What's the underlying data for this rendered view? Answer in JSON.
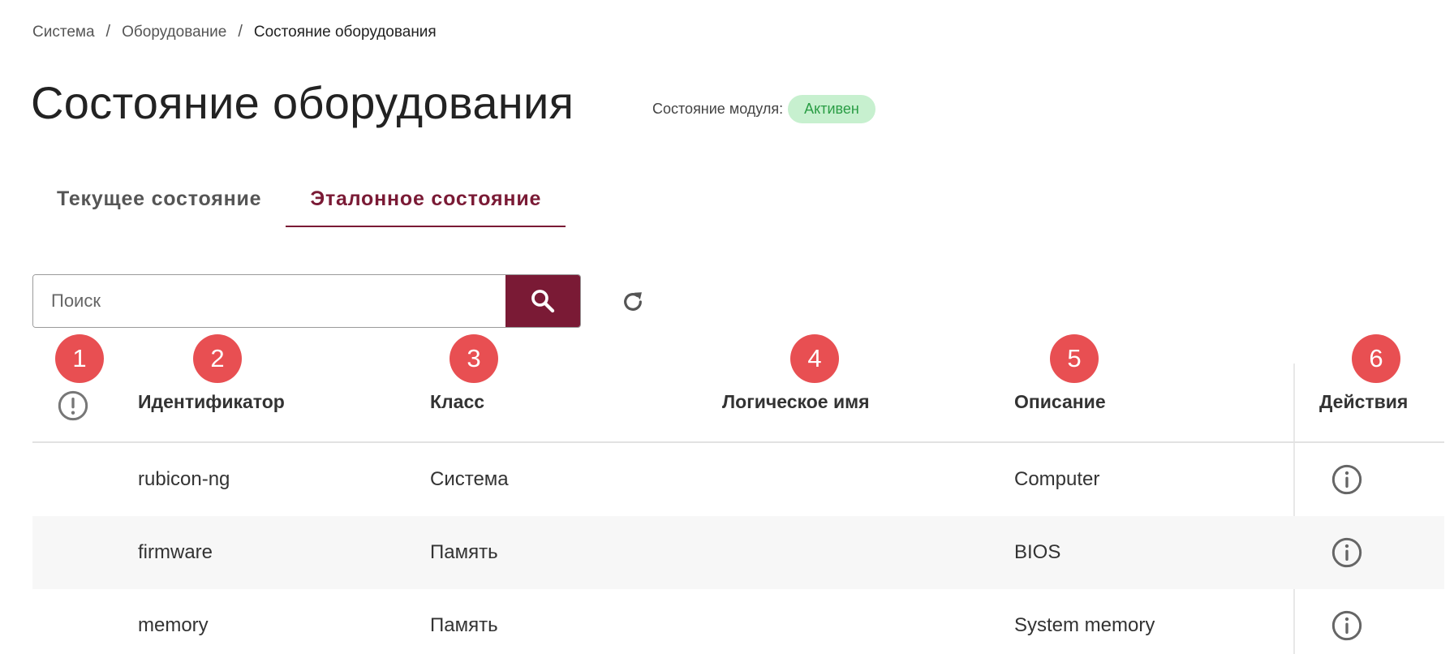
{
  "breadcrumb": {
    "items": [
      "Система",
      "Оборудование",
      "Состояние оборудования"
    ],
    "separator": "/"
  },
  "header": {
    "title": "Состояние оборудования",
    "module_state_label": "Состояние модуля:",
    "module_state_value": "Активен"
  },
  "tabs": [
    {
      "label": "Текущее состояние",
      "active": false
    },
    {
      "label": "Эталонное состояние",
      "active": true
    }
  ],
  "search": {
    "placeholder": "Поиск",
    "button_icon": "search-icon",
    "refresh_icon": "refresh-icon"
  },
  "markers": [
    "1",
    "2",
    "3",
    "4",
    "5",
    "6"
  ],
  "table": {
    "columns": [
      "",
      "Идентификатор",
      "Класс",
      "Логическое имя",
      "Описание",
      "Действия"
    ],
    "status_column_icon": "alert-circle-icon",
    "action_icon": "info-icon",
    "rows": [
      {
        "id": "rubicon-ng",
        "class": "Система",
        "logical_name": "",
        "description": "Computer"
      },
      {
        "id": "firmware",
        "class": "Память",
        "logical_name": "",
        "description": "BIOS"
      },
      {
        "id": "memory",
        "class": "Память",
        "logical_name": "",
        "description": "System memory"
      }
    ]
  },
  "colors": {
    "brand": "#7a1a35",
    "status_bg": "#c7f0cf",
    "status_text": "#2a9d45",
    "marker": "#e84f52"
  }
}
